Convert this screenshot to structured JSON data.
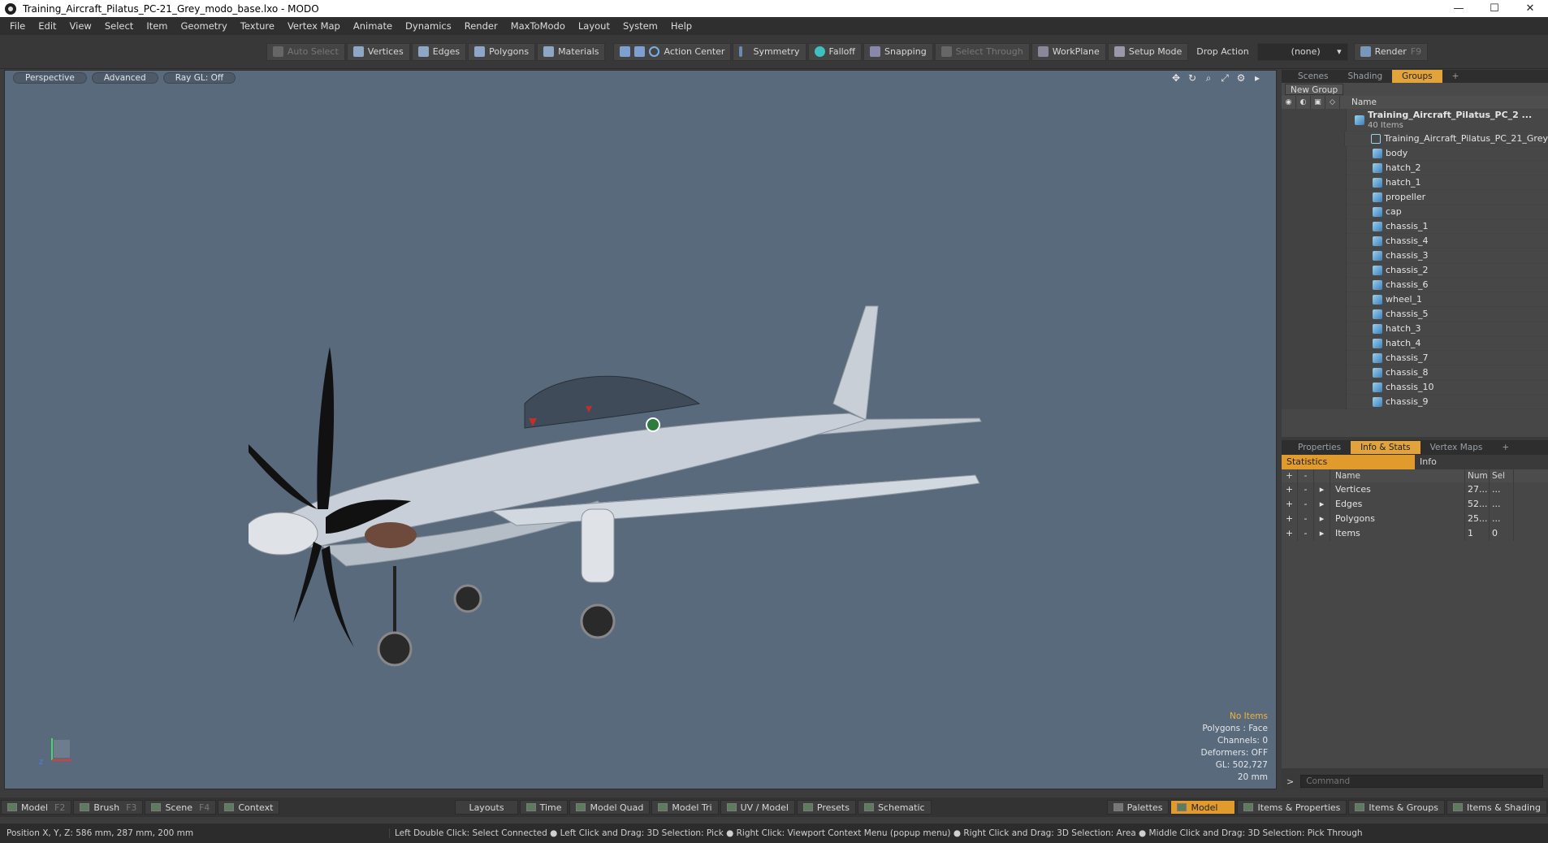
{
  "window": {
    "title": "Training_Aircraft_Pilatus_PC-21_Grey_modo_base.lxo - MODO",
    "minimize": "—",
    "maximize": "☐",
    "close": "✕"
  },
  "menu": [
    "File",
    "Edit",
    "View",
    "Select",
    "Item",
    "Geometry",
    "Texture",
    "Vertex Map",
    "Animate",
    "Dynamics",
    "Render",
    "MaxToModo",
    "Layout",
    "System",
    "Help"
  ],
  "toolbar": {
    "auto_select": "Auto Select",
    "vertices": "Vertices",
    "edges": "Edges",
    "polygons": "Polygons",
    "materials": "Materials",
    "action_center": "Action Center",
    "symmetry": "Symmetry",
    "falloff": "Falloff",
    "snapping": "Snapping",
    "select_through": "Select Through",
    "workplane": "WorkPlane",
    "setup_mode": "Setup Mode",
    "drop_action_label": "Drop Action",
    "drop_action_value": "(none)",
    "render": "Render",
    "render_key": "F9"
  },
  "viewport": {
    "tabs": [
      "Perspective",
      "Advanced",
      "Ray GL: Off"
    ],
    "overlay": {
      "no_items": "No Items",
      "polygons": "Polygons : Face",
      "channels": "Channels: 0",
      "deformers": "Deformers: OFF",
      "gl": "GL: 502,727",
      "scale": "20 mm"
    }
  },
  "scene_panel": {
    "tabs": [
      "Scenes",
      "Shading",
      "Groups"
    ],
    "active_tab": "Groups",
    "add_tab": "+",
    "new_group": "New Group",
    "name_header": "Name",
    "root_name": "Training_Aircraft_Pilatus_PC_2 ...",
    "root_count": "40 Items",
    "items": [
      "Training_Aircraft_Pilatus_PC_21_Grey",
      "body",
      "hatch_2",
      "hatch_1",
      "propeller",
      "cap",
      "chassis_1",
      "chassis_4",
      "chassis_3",
      "chassis_2",
      "chassis_6",
      "wheel_1",
      "chassis_5",
      "hatch_3",
      "hatch_4",
      "chassis_7",
      "chassis_8",
      "chassis_10",
      "chassis_9"
    ]
  },
  "stats_panel": {
    "tabs": [
      "Properties",
      "Info & Stats",
      "Vertex Maps"
    ],
    "add_tab": "+",
    "sub_tabs": [
      "Statistics",
      "Info"
    ],
    "columns": {
      "plus": "+",
      "minus": "-",
      "name": "Name",
      "num": "Num",
      "sel": "Sel"
    },
    "rows": [
      {
        "name": "Vertices",
        "num": "27...",
        "sel": "..."
      },
      {
        "name": "Edges",
        "num": "52...",
        "sel": "..."
      },
      {
        "name": "Polygons",
        "num": "25...",
        "sel": "..."
      },
      {
        "name": "Items",
        "num": "1",
        "sel": "0"
      }
    ],
    "command_placeholder": "Command"
  },
  "bottom": {
    "left": [
      {
        "label": "Model",
        "key": "F2"
      },
      {
        "label": "Brush",
        "key": "F3"
      },
      {
        "label": "Scene",
        "key": "F4"
      },
      {
        "label": "Context",
        "key": ""
      }
    ],
    "center": [
      "Layouts",
      "Time",
      "Model Quad",
      "Model Tri",
      "UV / Model",
      "Presets",
      "Schematic"
    ],
    "right": [
      "Palettes",
      "Model",
      "Items & Properties",
      "Items & Groups",
      "Items & Shading"
    ]
  },
  "status": {
    "position": "Position X, Y, Z:   586 mm, 287 mm, 200 mm",
    "hints": "Left Double Click: Select Connected ● Left Click and Drag: 3D Selection: Pick ● Right Click: Viewport Context Menu (popup menu) ● Right Click and Drag: 3D Selection: Area ● Middle Click and Drag: 3D Selection: Pick Through"
  },
  "colors": {
    "accent": "#e19a2c",
    "viewport_bg": "#5a6a7d",
    "mesh_icon": "#6fb3e0"
  }
}
